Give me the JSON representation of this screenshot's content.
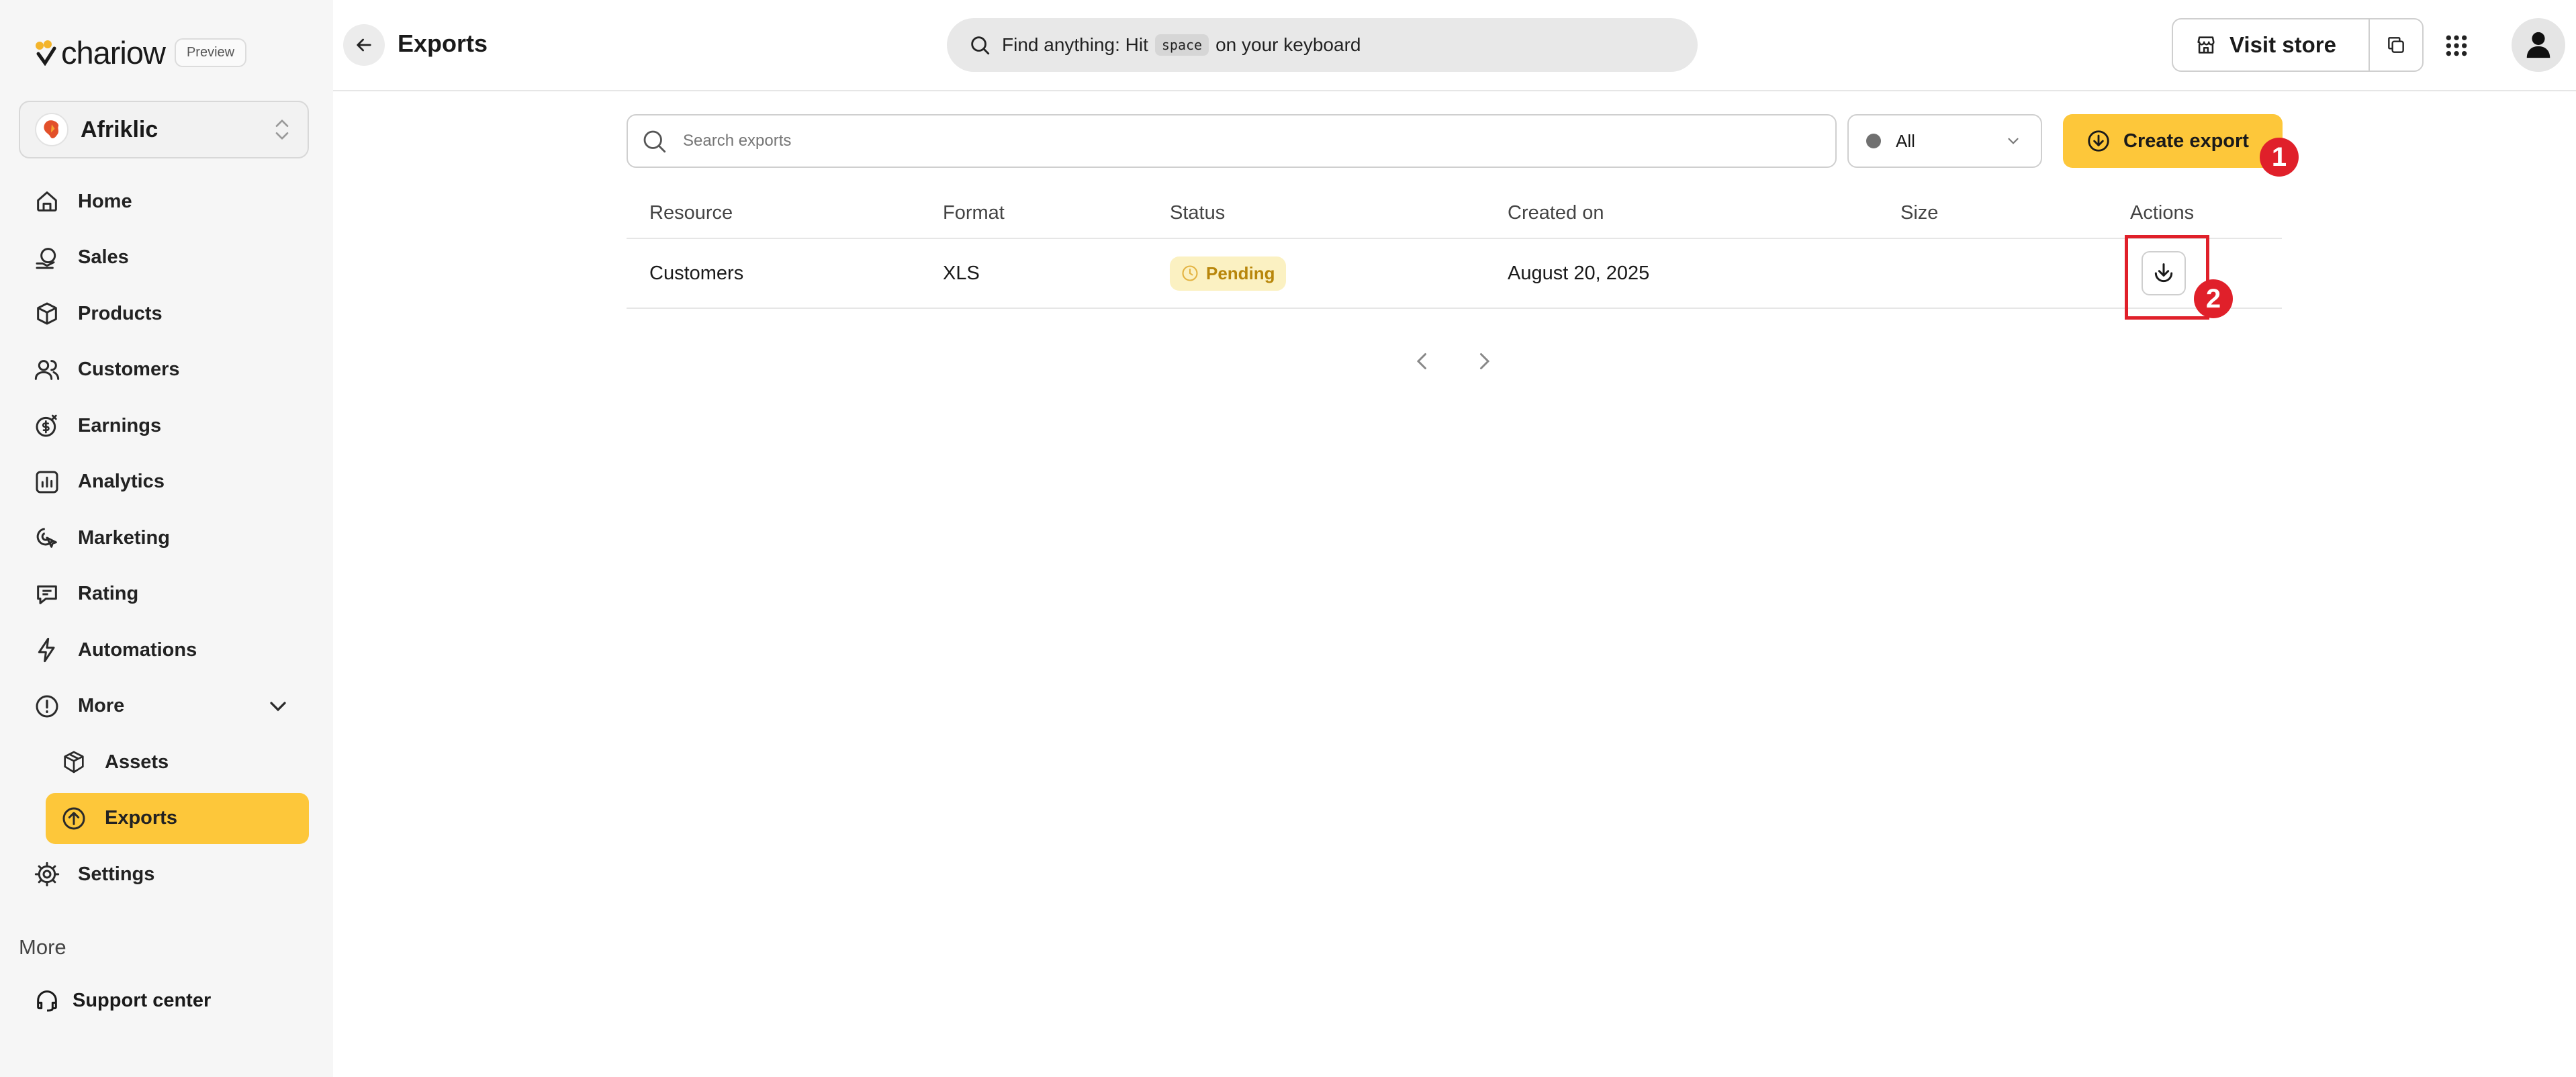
{
  "sidebar": {
    "logo": "chariow",
    "preview_badge": "Preview",
    "store_name": "Afriklic",
    "nav": [
      {
        "label": "Home",
        "icon": "home-icon"
      },
      {
        "label": "Sales",
        "icon": "sales-icon"
      },
      {
        "label": "Products",
        "icon": "box-icon"
      },
      {
        "label": "Customers",
        "icon": "users-icon"
      },
      {
        "label": "Earnings",
        "icon": "earnings-icon"
      },
      {
        "label": "Analytics",
        "icon": "analytics-icon"
      },
      {
        "label": "Marketing",
        "icon": "marketing-icon"
      },
      {
        "label": "Rating",
        "icon": "rating-icon"
      },
      {
        "label": "Automations",
        "icon": "lightning-icon"
      },
      {
        "label": "More",
        "icon": "info-circle-icon"
      }
    ],
    "sub_nav": [
      {
        "label": "Assets",
        "icon": "cube-icon"
      },
      {
        "label": "Exports",
        "icon": "upload-circle-icon"
      }
    ],
    "settings_label": "Settings",
    "more_heading": "More",
    "support_label": "Support center"
  },
  "topbar": {
    "title": "Exports",
    "search_prefix": "Find anything: Hit",
    "search_key": "space",
    "search_suffix": "on your keyboard",
    "visit_store": "Visit store"
  },
  "toolbar": {
    "search_placeholder": "Search exports",
    "status_filter": "All",
    "create_label": "Create export"
  },
  "table": {
    "headers": [
      "Resource",
      "Format",
      "Status",
      "Created on",
      "Size",
      "Actions"
    ],
    "rows": [
      {
        "resource": "Customers",
        "format": "XLS",
        "status": "Pending",
        "created_on": "August 20, 2025",
        "size": ""
      }
    ]
  },
  "annotations": {
    "callout_1": "1",
    "callout_2": "2"
  },
  "colors": {
    "accent": "#fdc73a",
    "callout": "#e0202a",
    "pending_bg": "#fbf1c2",
    "pending_text": "#b8860b"
  }
}
